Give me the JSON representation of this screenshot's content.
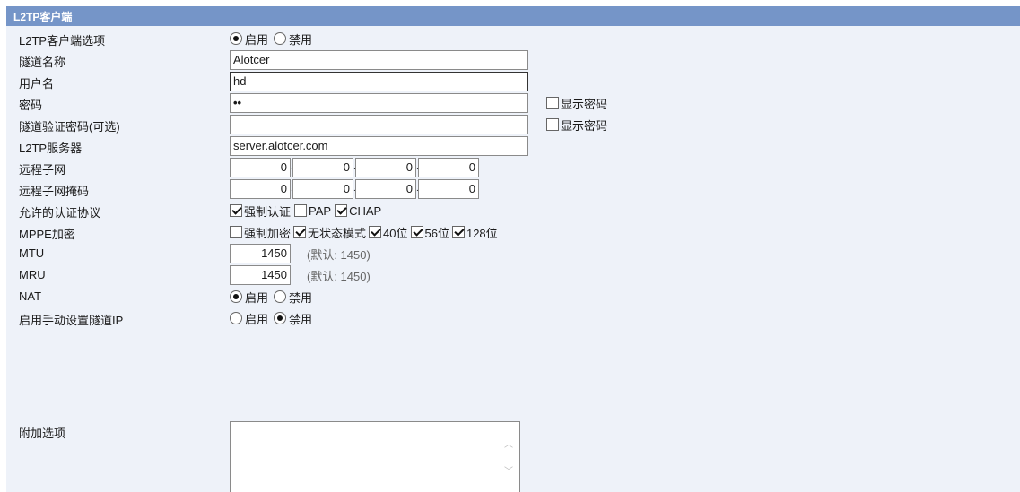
{
  "title": "L2TP客户端",
  "rows": {
    "client_option": {
      "label": "L2TP客户端选项",
      "enable": "启用",
      "disable": "禁用",
      "selected": "enable"
    },
    "tunnel_name": {
      "label": "隧道名称",
      "value": "Alotcer"
    },
    "username": {
      "label": "用户名",
      "value": "hd"
    },
    "password": {
      "label": "密码",
      "value": "••",
      "show_label": "显示密码"
    },
    "tunnel_auth": {
      "label": "隧道验证密码(可选)",
      "value": "",
      "show_label": "显示密码"
    },
    "server": {
      "label": "L2TP服务器",
      "value": "server.alotcer.com"
    },
    "remote_subnet": {
      "label": "远程子网",
      "octets": [
        "0",
        "0",
        "0",
        "0"
      ]
    },
    "remote_mask": {
      "label": "远程子网掩码",
      "octets": [
        "0",
        "0",
        "0",
        "0"
      ]
    },
    "auth_protocols": {
      "label": "允许的认证协议",
      "options": [
        {
          "label": "强制认证",
          "checked": true
        },
        {
          "label": "PAP",
          "checked": false
        },
        {
          "label": "CHAP",
          "checked": true
        }
      ]
    },
    "mppe": {
      "label": "MPPE加密",
      "options": [
        {
          "label": "强制加密",
          "checked": false
        },
        {
          "label": "无状态模式",
          "checked": true
        },
        {
          "label": "40位",
          "checked": true
        },
        {
          "label": "56位",
          "checked": true
        },
        {
          "label": "128位",
          "checked": true
        }
      ]
    },
    "mtu": {
      "label": "MTU",
      "value": "1450",
      "hint": "(默认: 1450)"
    },
    "mru": {
      "label": "MRU",
      "value": "1450",
      "hint": "(默认: 1450)"
    },
    "nat": {
      "label": "NAT",
      "enable": "启用",
      "disable": "禁用",
      "selected": "enable"
    },
    "manual_ip": {
      "label": "启用手动设置隧道IP",
      "enable": "启用",
      "disable": "禁用",
      "selected": "disable"
    },
    "extra": {
      "label": "附加选项",
      "value": ""
    }
  }
}
